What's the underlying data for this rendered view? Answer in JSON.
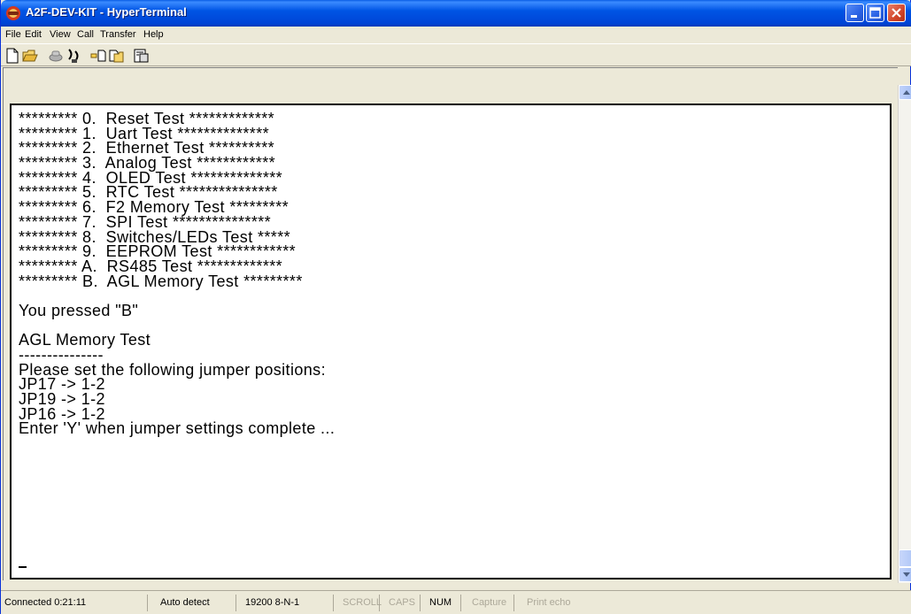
{
  "window": {
    "title": "A2F-DEV-KIT - HyperTerminal",
    "icon": "hyperterminal-phone-icon"
  },
  "menu": {
    "items": [
      "File",
      "Edit",
      "View",
      "Call",
      "Transfer",
      "Help"
    ]
  },
  "toolbar": {
    "buttons": [
      "new-connection-icon",
      "open-icon",
      "disconnect-icon",
      "connect-icon",
      "send-icon",
      "receive-icon",
      "properties-icon"
    ]
  },
  "terminal": {
    "lines": [
      "********* 0.  Reset Test *************",
      "********* 1.  Uart Test **************",
      "********* 2.  Ethernet Test **********",
      "********* 3.  Analog Test ************",
      "********* 4.  OLED Test **************",
      "********* 5.  RTC Test ***************",
      "********* 6.  F2 Memory Test *********",
      "********* 7.  SPI Test ***************",
      "********* 8.  Switches/LEDs Test *****",
      "********* 9.  EEPROM Test ************",
      "********* A.  RS485 Test *************",
      "********* B.  AGL Memory Test *********",
      "",
      "You pressed \"B\"",
      "",
      "AGL Memory Test",
      "---------------",
      "Please set the following jumper positions:",
      "JP17 -> 1-2",
      "JP19 -> 1-2",
      "JP16 -> 1-2",
      "Enter 'Y' when jumper settings complete ..."
    ]
  },
  "status": {
    "connected": "Connected 0:21:11",
    "detect": "Auto detect",
    "settings": "19200 8-N-1",
    "scroll": "SCROLL",
    "caps": "CAPS",
    "num": "NUM",
    "capture": "Capture",
    "print_echo": "Print echo"
  }
}
